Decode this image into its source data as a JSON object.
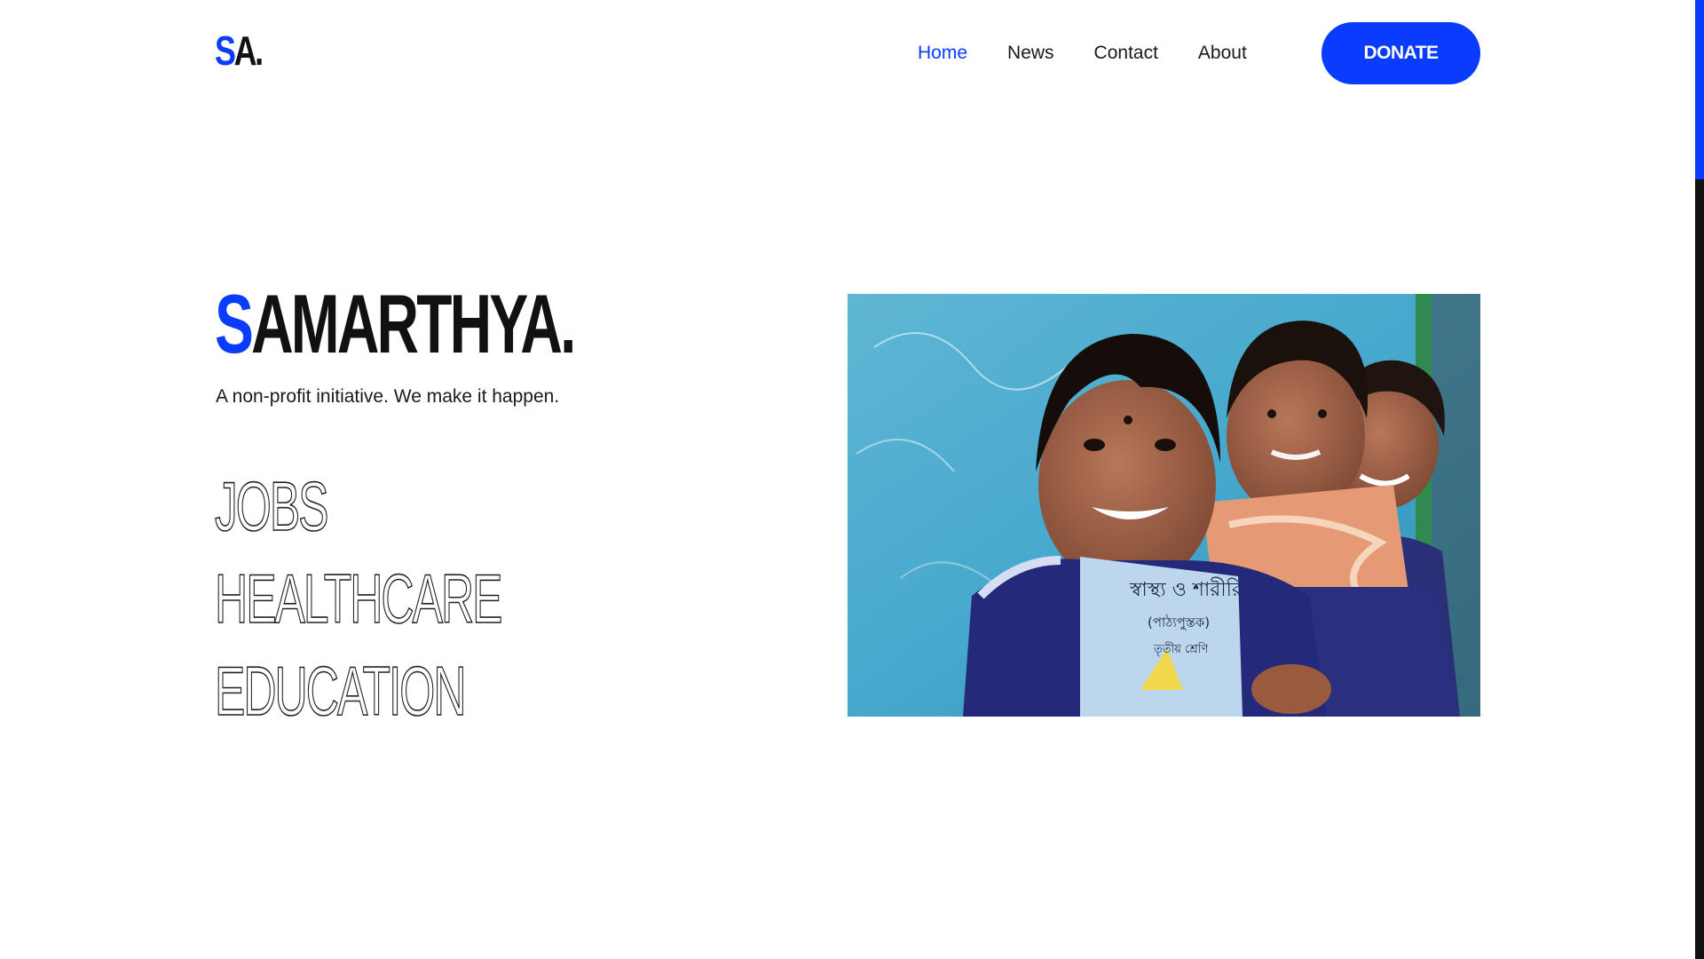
{
  "brand": {
    "logo_initial": "S",
    "logo_rest": "A."
  },
  "nav": {
    "items": [
      {
        "label": "Home",
        "active": true
      },
      {
        "label": "News",
        "active": false
      },
      {
        "label": "Contact",
        "active": false
      },
      {
        "label": "About",
        "active": false
      }
    ],
    "donate_label": "DONATE"
  },
  "hero": {
    "title_initial": "S",
    "title_rest": "AMARTHYA.",
    "tagline": "A non-profit initiative. We make it happen.",
    "focus_areas": [
      "JOBS",
      "HEALTHCARE",
      "EDUCATION"
    ]
  },
  "image": {
    "book_title": "স্বাস্থ্য ও শারীরি",
    "book_subtitle": "(পাঠ্যপুস্তক)",
    "book_grade": "তৃতীয় শ্রেণি"
  },
  "colors": {
    "accent": "#0a3cff",
    "text": "#111111",
    "background": "#ffffff"
  }
}
